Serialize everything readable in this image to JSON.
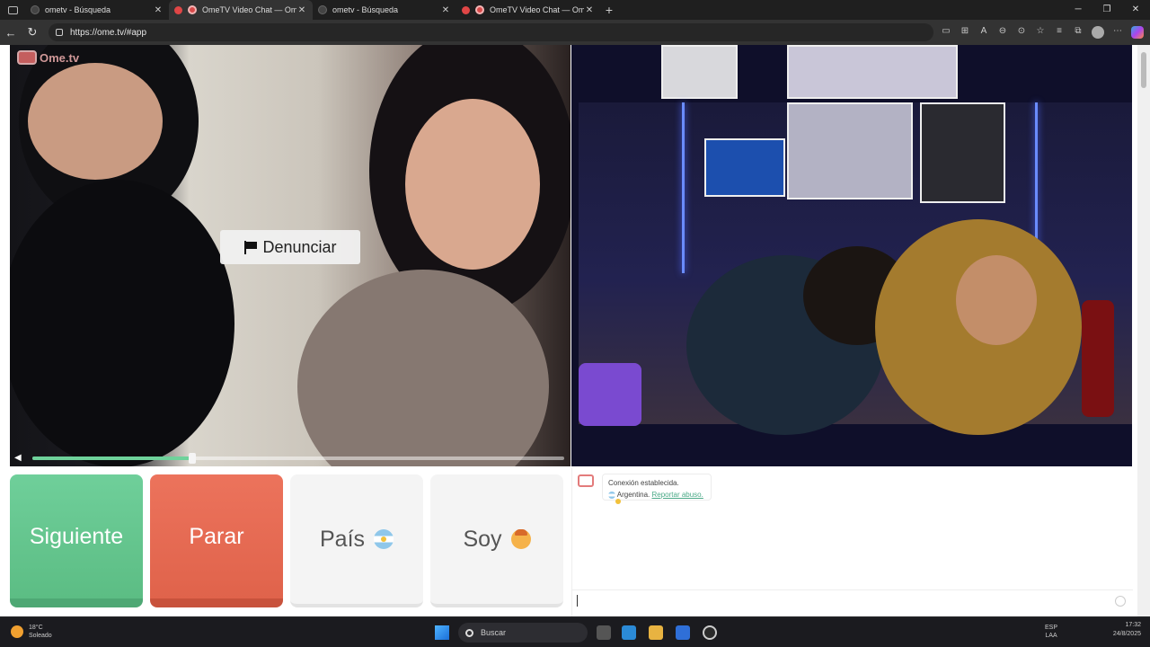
{
  "browser": {
    "tabs": [
      {
        "title": "ometv - Búsqueda",
        "icon": "search-favicon",
        "active": false
      },
      {
        "title": "OmeTV Video Chat — Omeg",
        "icon": "ometv-favicon",
        "active": true,
        "recording": true
      },
      {
        "title": "ometv - Búsqueda",
        "icon": "search-favicon",
        "active": false
      },
      {
        "title": "OmeTV Video Chat — Omeg",
        "icon": "ometv-favicon",
        "active": false,
        "recording": true
      }
    ],
    "new_tab": "+",
    "url": "https://ome.tv/#app"
  },
  "app": {
    "logo_text": "Ome.tv",
    "report_button": "Denunciar",
    "volume_level": 0.3,
    "buttons": {
      "next": "Siguiente",
      "stop": "Parar",
      "country": "País",
      "gender": "Soy"
    },
    "chat": {
      "connection_message": "Conexión establecida.",
      "country": "Argentina.",
      "report_link": "Reportar abuso."
    }
  },
  "taskbar": {
    "weather_temp": "18°C",
    "weather_desc": "Soleado",
    "search_placeholder": "Buscar",
    "language_top": "ESP",
    "language_bottom": "LAA",
    "time": "17:32",
    "date": "24/8/2025"
  },
  "colors": {
    "next": "#6fcf9a",
    "stop": "#ec735c",
    "accent_link": "#4aa987"
  }
}
